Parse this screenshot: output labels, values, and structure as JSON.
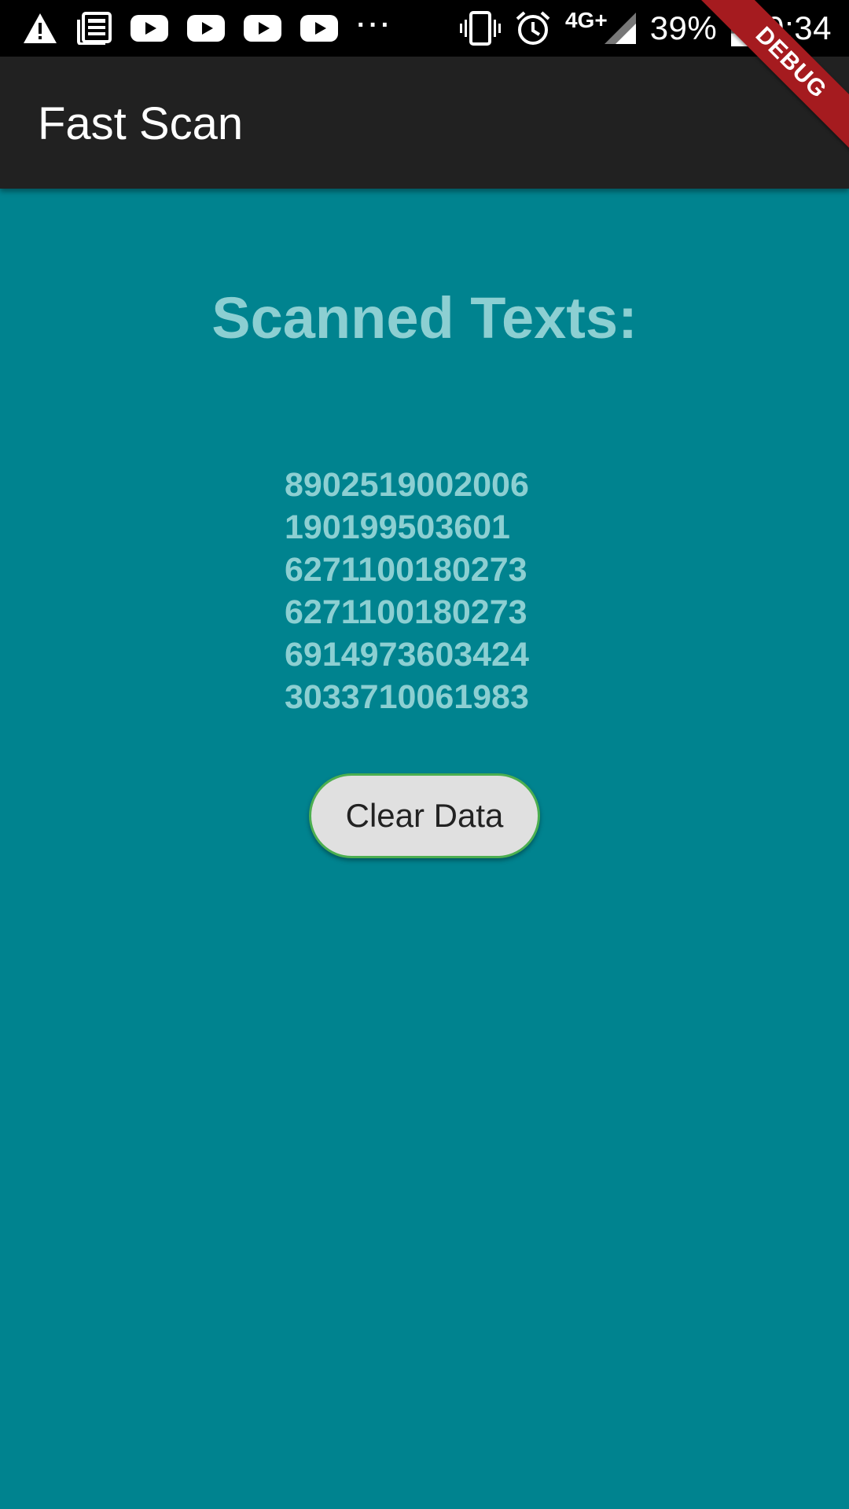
{
  "status_bar": {
    "left_icons": [
      "warning-icon",
      "news-icon",
      "youtube-icon",
      "youtube-icon",
      "youtube-icon",
      "youtube-icon"
    ],
    "more_indicator": "···",
    "network": "4G+",
    "battery_percent": "39%",
    "battery_level": 0.39,
    "time": "9:34"
  },
  "app_bar": {
    "title": "Fast Scan"
  },
  "debug_banner": "DEBUG",
  "main": {
    "heading": "Scanned Texts:",
    "scanned_codes": [
      "8902519002006",
      "190199503601",
      "6271100180273",
      "6271100180273",
      "6914973603424",
      "3033710061983"
    ],
    "clear_button_label": "Clear Data"
  },
  "colors": {
    "background": "#00838f",
    "app_bar": "#212121",
    "text_accent": "#8ccfd2",
    "button_bg": "#e0e0e0",
    "button_border": "#4caf50",
    "debug_banner": "#a51b1f"
  }
}
